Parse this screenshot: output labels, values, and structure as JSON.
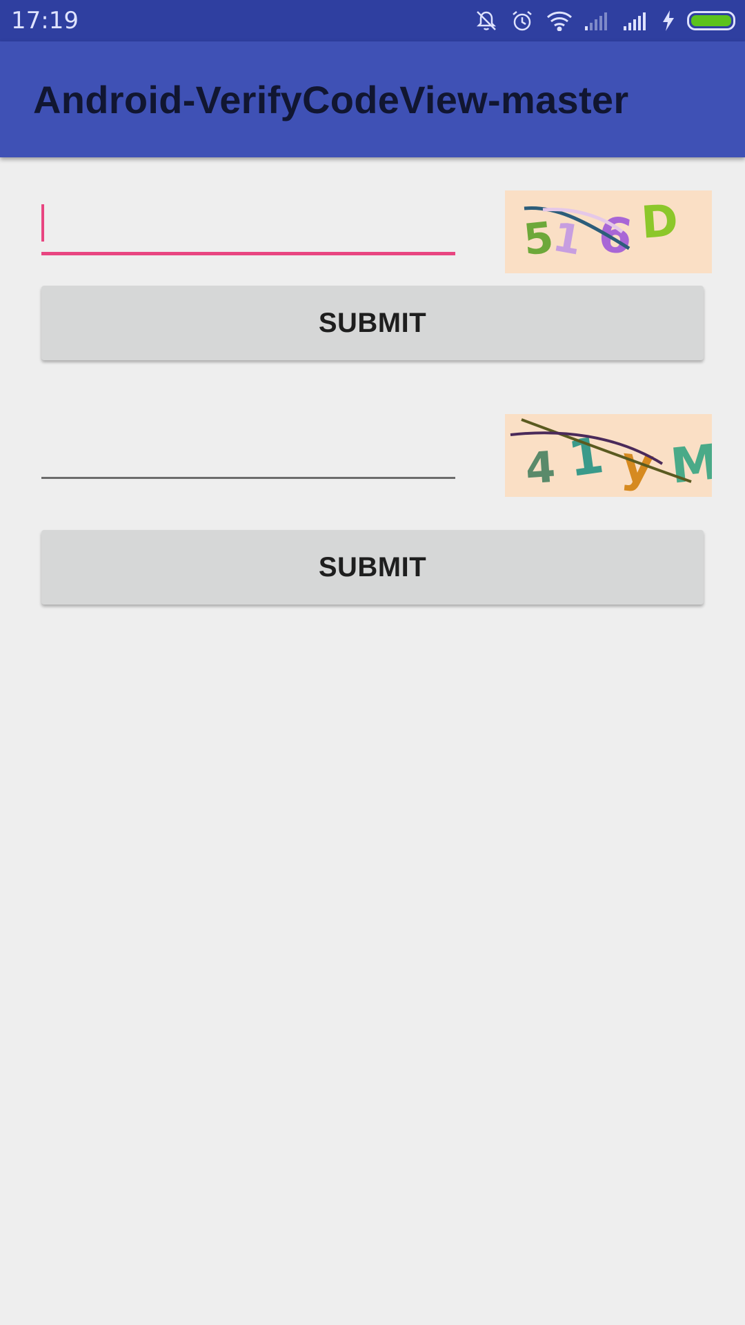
{
  "status_bar": {
    "time": "17:19",
    "icons": [
      "mute-vibrate-icon",
      "alarm-icon",
      "wifi-icon",
      "signal-weak-icon",
      "signal-strong-icon",
      "charging-icon",
      "battery-icon"
    ],
    "battery_color": "#5cc21d"
  },
  "app_bar": {
    "title": "Android-VerifyCodeView-master",
    "color": "#3f51b5"
  },
  "form1": {
    "input_value": "",
    "captcha_text": "516D",
    "submit_label": "SUBMIT"
  },
  "form2": {
    "input_value": "",
    "captcha_text": "41yM",
    "submit_label": "SUBMIT"
  },
  "colors": {
    "accent": "#e84580",
    "background": "#eeeeee",
    "captcha_bg": "#fadfc5"
  }
}
